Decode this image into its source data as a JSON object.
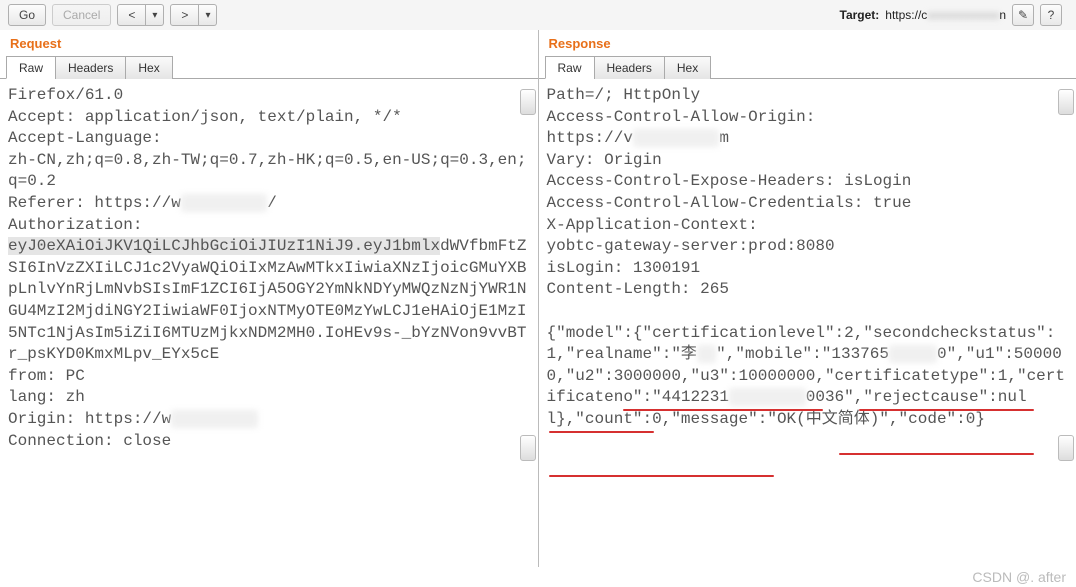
{
  "toolbar": {
    "go": "Go",
    "cancel": "Cancel",
    "prev": "<",
    "next": ">",
    "drop": "▾",
    "target_label": "Target:",
    "target_prefix": "https://c",
    "target_blur": "xxxxxxxxxxxx",
    "target_suffix": "n",
    "edit_icon": "✎",
    "help_icon": "?"
  },
  "left": {
    "title": "Request",
    "tabs": {
      "raw": "Raw",
      "headers": "Headers",
      "hex": "Hex"
    },
    "body": "Firefox/61.0\nAccept: application/json, text/plain, */*\nAccept-Language: \nzh-CN,zh;q=0.8,zh-TW;q=0.7,zh-HK;q=0.5,en-US;q=0.3,en;q=0.2\nReferer: https://w",
    "body_blur1": "xxxxxxxxx",
    "body_after_ref": "/\nAuthorization: \n",
    "auth_token_sel": "eyJ0eXAiOiJKV1QiLCJhbGciOiJIUzI1NiJ9.eyJ1bmlx",
    "auth_token_rest": "dWVfbmFtZSI6InVzZXIiLCJ1c2VyaWQiOiIxMzAwMTkxIiwiaXNzIjoicGMuYXBpLnlvYnRjLmNvbSIsImF1ZCI6IjA5OGY2YmNkNDYyMWQzNzNjYWR1NGU4MzI2MjdiNGY2IiwiaWF0IjoxNTMyOTE0MzYwLCJ1eHAiOjE1MzI5NTc1NjAsIm5iZiI6MTUzMjkxNDM2MH0.IoHEv9s-_bYzNVon9vvBTr_psKYD0KmxMLpv_EYx5cE\nfrom: PC\nlang: zh\nOrigin: https://w",
    "body_blur2": "xxxxxxxxx",
    "body_end": "\nConnection: close"
  },
  "right": {
    "title": "Response",
    "tabs": {
      "raw": "Raw",
      "headers": "Headers",
      "hex": "Hex"
    },
    "body_a": "Path=/; HttpOnly\nAccess-Control-Allow-Origin: \nhttps://v",
    "blur_a": "xxxxxxxxx",
    "body_b": "m\nVary: Origin\nAccess-Control-Expose-Headers: isLogin\nAccess-Control-Allow-Credentials: true\nX-Application-Context: \nyobtc-gateway-server:prod:8080\nisLogin: 1300191\nContent-Length: 265\n\n{\"model\":{\"certificationlevel\":2,\"secondcheckstatus\":1,\"realname\":\"李",
    "blur_name": "XX",
    "body_c": "\",\"mobile\":\"133765",
    "blur_mobile": "xxxxx",
    "body_d": "0\",\"u1\":500000,\"u2\":3000000,\"u3\":10000000,\"certificatetype\":1,\"certificateno\":\"4412231",
    "blur_cert": "xxxxxxxx",
    "body_e": "0036\",\"rejectcause\":null},\"count\":0,\"message\":\"OK(中文简体)\",\"code\":0}"
  },
  "chart_data": {
    "type": "table",
    "title": "Response JSON model fields (values partially redacted in screenshot)",
    "fields": [
      {
        "key": "certificationlevel",
        "value": 2
      },
      {
        "key": "secondcheckstatus",
        "value": 1
      },
      {
        "key": "realname",
        "value": "李[redacted]"
      },
      {
        "key": "mobile",
        "value": "133765[redacted]0"
      },
      {
        "key": "u1",
        "value": 500000
      },
      {
        "key": "u2",
        "value": 3000000
      },
      {
        "key": "u3",
        "value": 10000000
      },
      {
        "key": "certificatetype",
        "value": 1
      },
      {
        "key": "certificateno",
        "value": "4412231[redacted]0036"
      },
      {
        "key": "rejectcause",
        "value": null
      },
      {
        "key": "count",
        "value": 0
      },
      {
        "key": "message",
        "value": "OK(中文简体)"
      },
      {
        "key": "code",
        "value": 0
      }
    ]
  },
  "watermark": "CSDN @. after"
}
